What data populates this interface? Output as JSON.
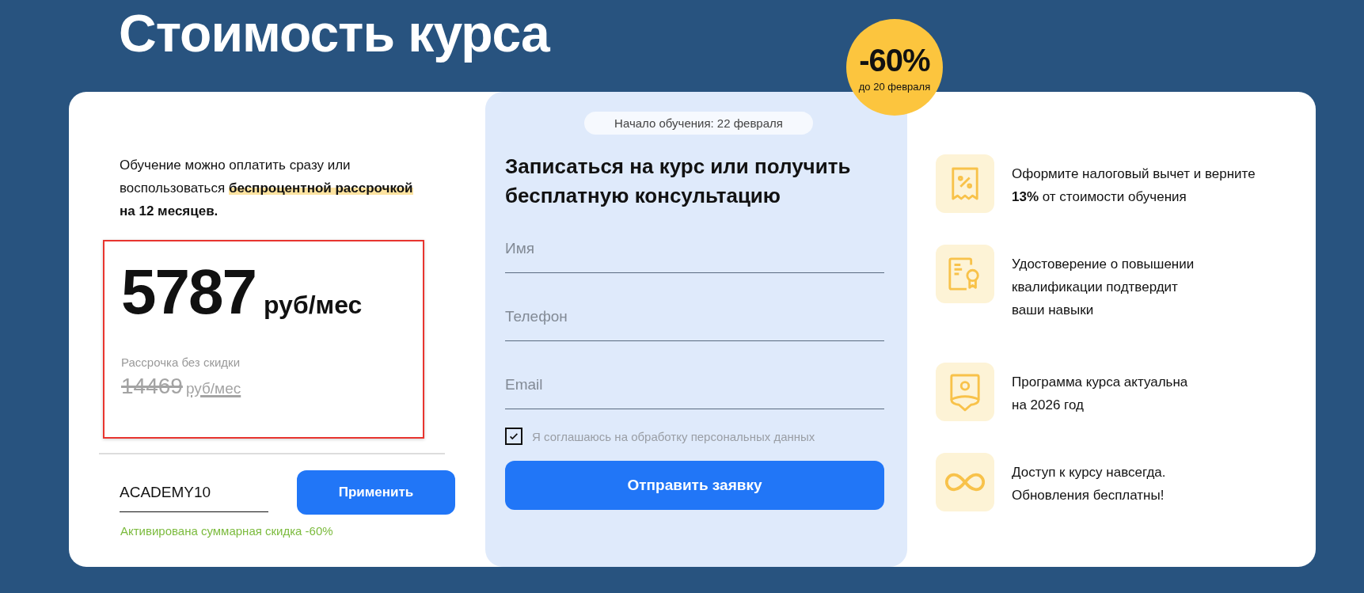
{
  "title": "Стоимость курса",
  "badge": {
    "discount": "-60%",
    "until": "до 20 февраля"
  },
  "payment": {
    "intro": [
      {
        "text": "Обучение можно оплатить сразу или воспользоваться ",
        "kind": "plain"
      },
      {
        "text": "беспроцентной рассрочкой",
        "kind": "highlight"
      },
      {
        "text": " на 12 месяцев.",
        "kind": "bold"
      }
    ],
    "price": "5787",
    "price_unit": "руб/мес",
    "old_label": "Рассрочка без скидки",
    "old_price": "14469",
    "old_unit": "руб/мес",
    "promo": {
      "value": "ACADEMY10",
      "button": "Применить",
      "status": "Активирована суммарная скидка -60%"
    }
  },
  "form": {
    "start": "Начало обучения: 22 февраля",
    "heading": "Записаться на курс или получить бесплатную консультацию",
    "fields": [
      {
        "placeholder": "Имя"
      },
      {
        "placeholder": "Телефон"
      },
      {
        "placeholder": "Email"
      }
    ],
    "consent": {
      "label": "Я соглашаюсь на обработку персональных данных",
      "checked": true
    },
    "submit": "Отправить заявку"
  },
  "benefits": [
    {
      "kind": "receipt",
      "lines": [
        "Оформите налоговый вычет и верните",
        "**13%** от стоимости обучения"
      ]
    },
    {
      "kind": "certificate",
      "lines": [
        "Удостоверение о повышении",
        "квалификации подтвердит",
        "ваши навыки"
      ]
    },
    {
      "kind": "badge",
      "lines": [
        "Программа курса актуальна",
        "на 2026 год"
      ]
    },
    {
      "kind": "infinity",
      "lines": [
        "Доступ к курсу навсегда.",
        "Обновления бесплатны!"
      ]
    }
  ]
}
